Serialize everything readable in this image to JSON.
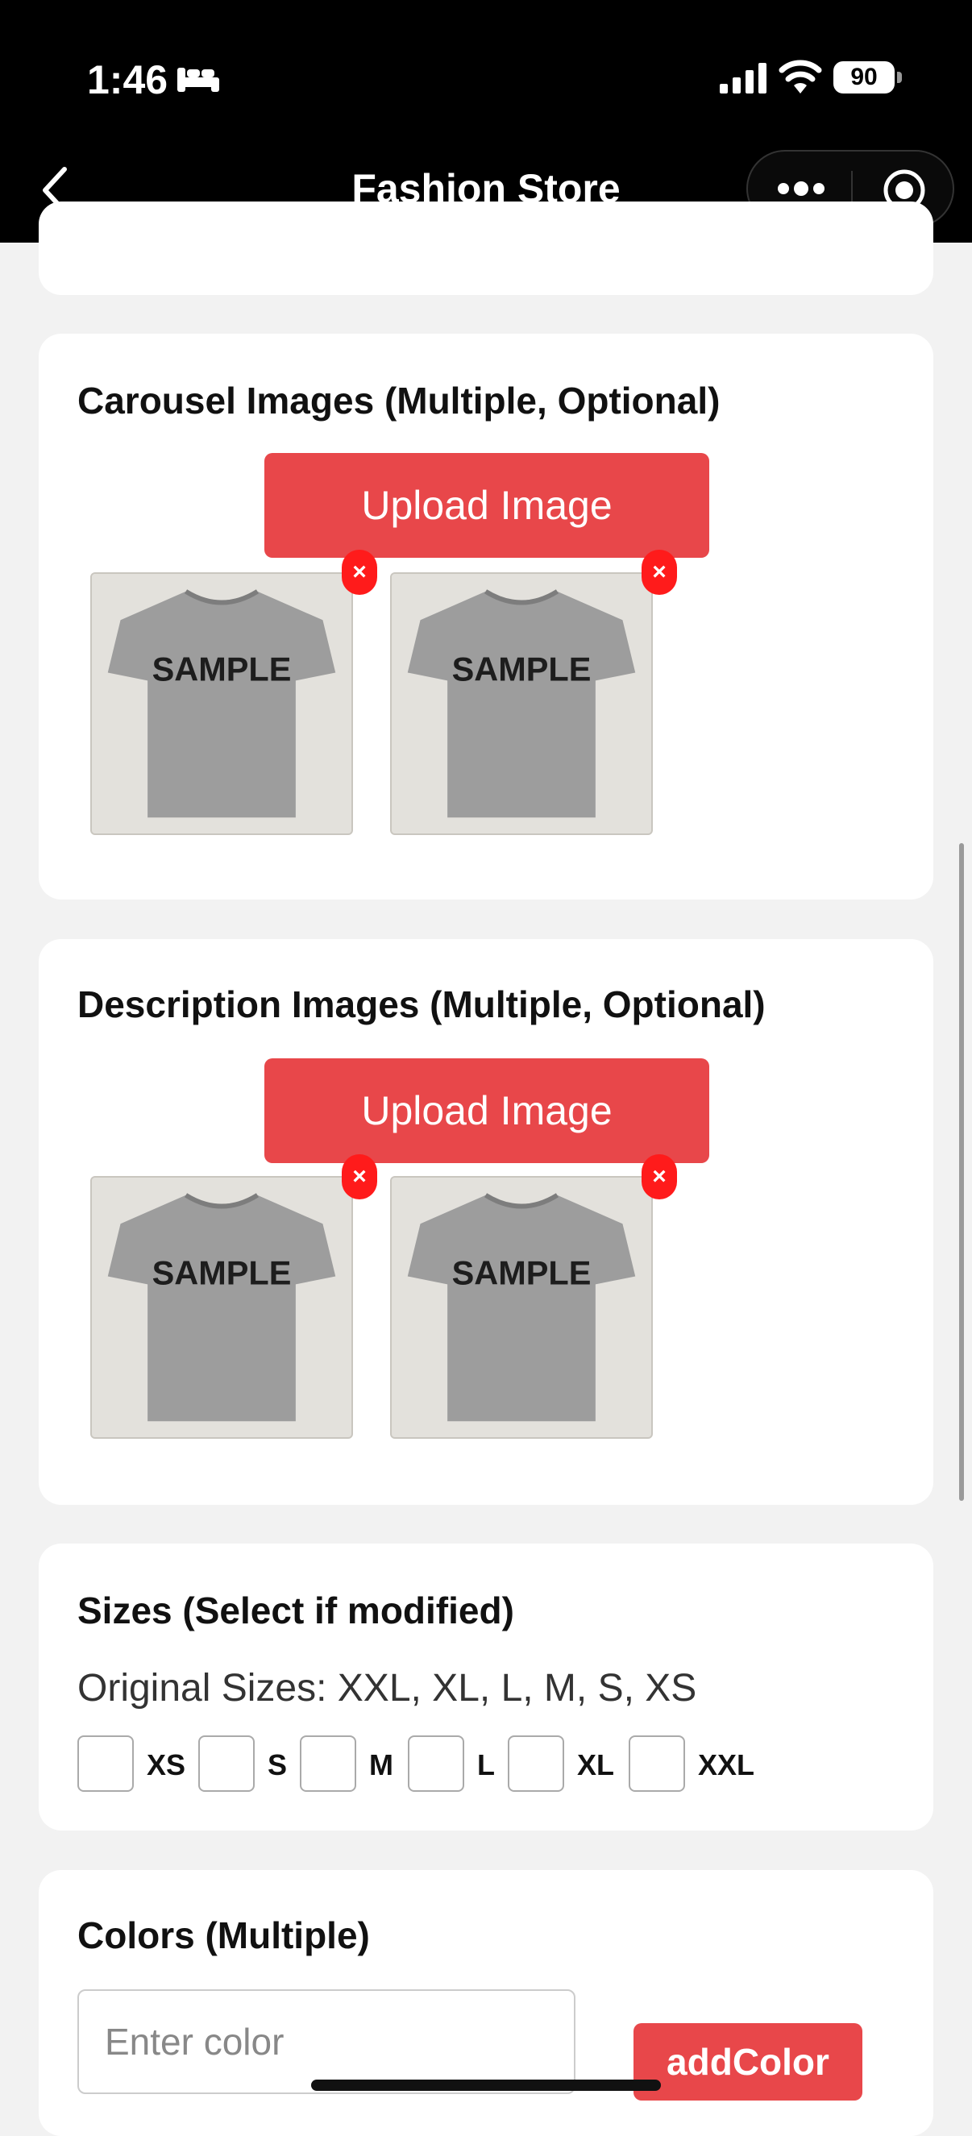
{
  "status_bar": {
    "time": "1:46",
    "battery": "90"
  },
  "nav": {
    "title": "Fashion Store"
  },
  "carousel": {
    "title": "Carousel Images (Multiple, Optional)",
    "upload_label": "Upload Image",
    "images": [
      {
        "text": "SAMPLE"
      },
      {
        "text": "SAMPLE"
      }
    ],
    "delete_symbol": "×"
  },
  "description": {
    "title": "Description Images (Multiple, Optional)",
    "upload_label": "Upload Image",
    "images": [
      {
        "text": "SAMPLE"
      },
      {
        "text": "SAMPLE"
      }
    ],
    "delete_symbol": "×"
  },
  "sizes": {
    "title": "Sizes (Select if modified)",
    "original": "Original Sizes: XXL, XL, L, M, S, XS",
    "options": [
      "XS",
      "S",
      "M",
      "L",
      "XL",
      "XXL"
    ]
  },
  "colors": {
    "title": "Colors (Multiple)",
    "input_placeholder": "Enter color",
    "add_label": "addColor"
  },
  "theme": {
    "accent": "#e8474a",
    "delete_red": "#ff1b1b"
  }
}
